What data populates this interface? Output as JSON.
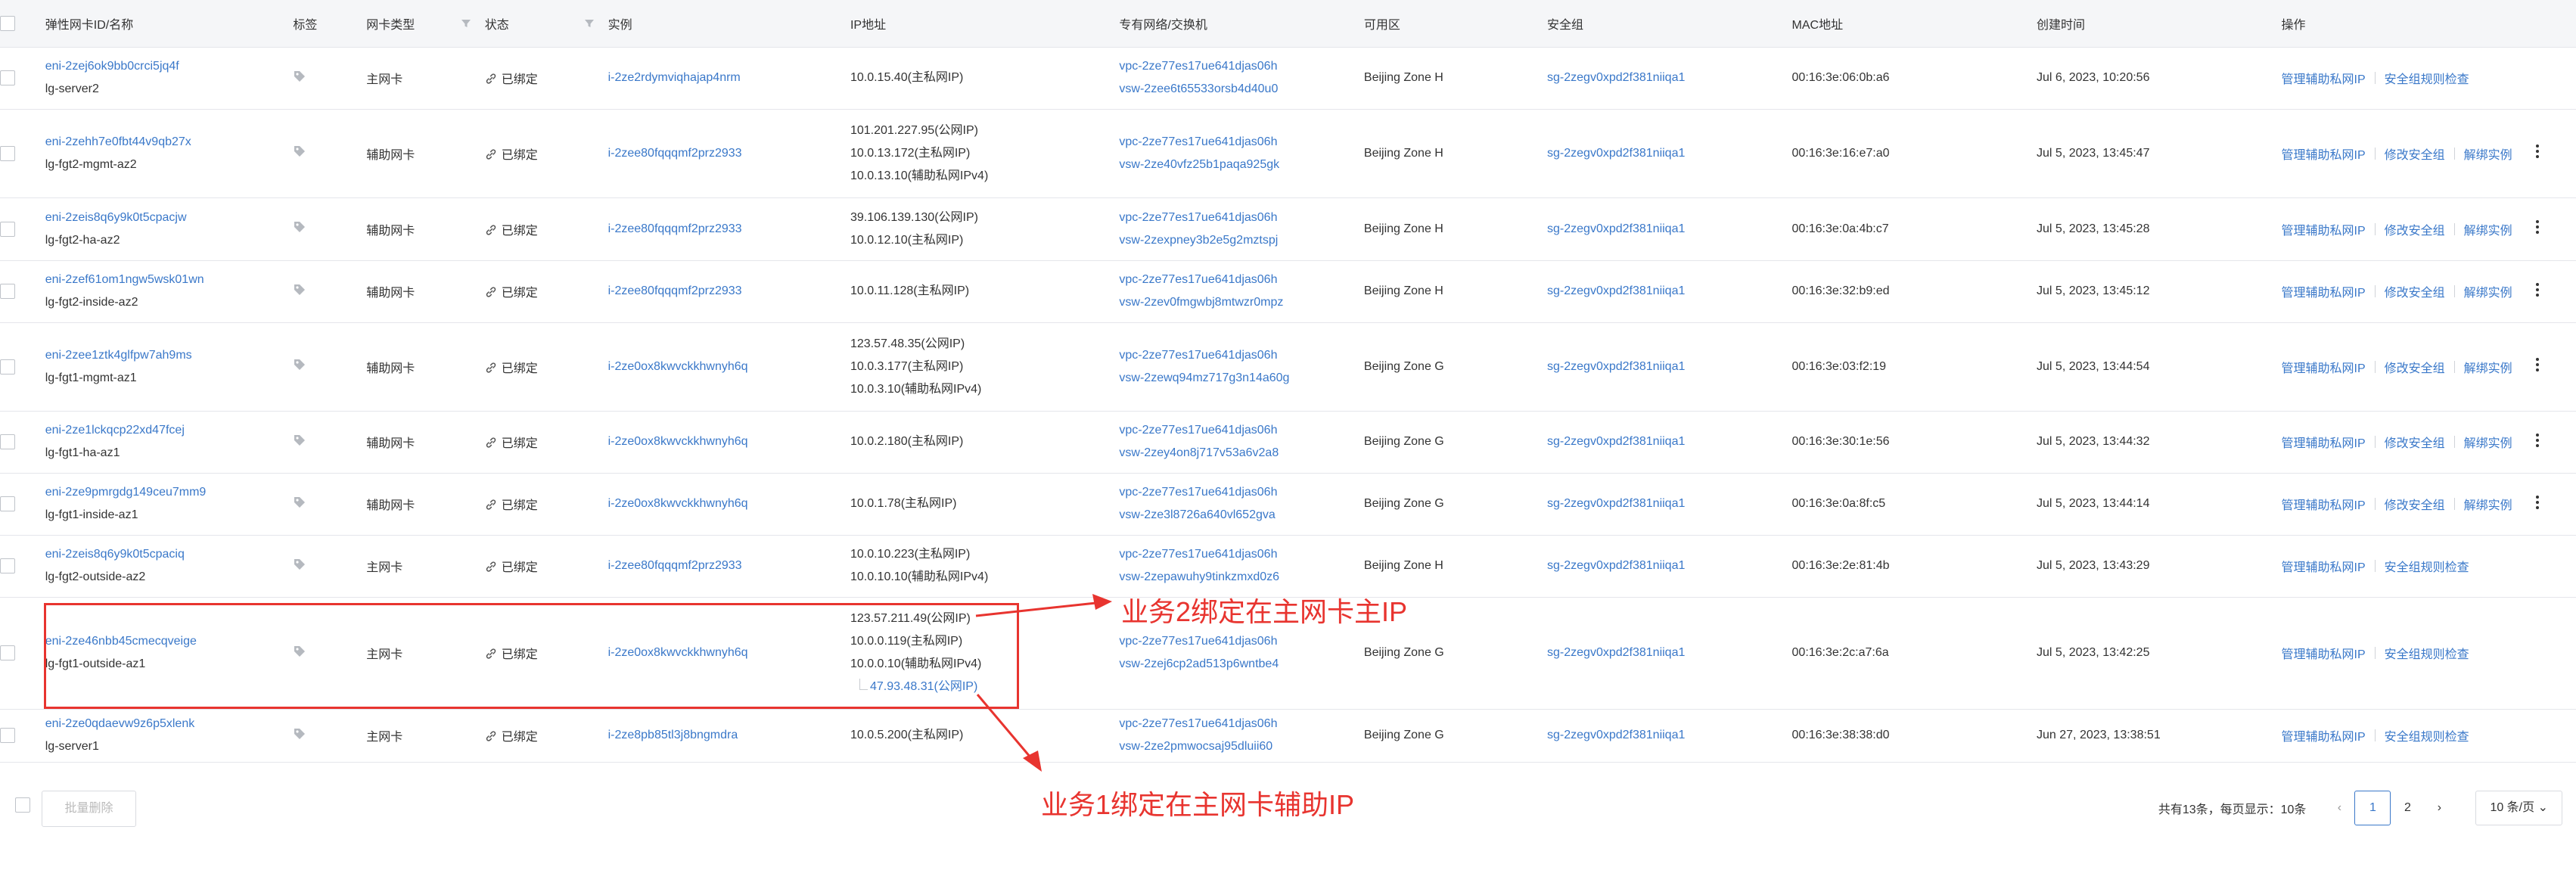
{
  "headers": {
    "id": "弹性网卡ID/名称",
    "tag": "标签",
    "type": "网卡类型",
    "status": "状态",
    "instance": "实例",
    "ip": "IP地址",
    "vpc": "专有网络/交换机",
    "zone": "可用区",
    "sg": "安全组",
    "mac": "MAC地址",
    "created": "创建时间",
    "ops": "操作"
  },
  "ops": {
    "manage_ip": "管理辅助私网IP",
    "sg_check": "安全组规则检查",
    "modify_sg": "修改安全组",
    "unbind": "解绑实例"
  },
  "rows": [
    {
      "id": "eni-2zej6ok9bb0crci5jq4f",
      "name": "lg-server2",
      "type": "主网卡",
      "status": "已绑定",
      "instance": "i-2ze2rdymviqhajap4nrm",
      "ips": [
        "10.0.15.40(主私网IP)"
      ],
      "vpc": "vpc-2ze77es17ue641djas06h",
      "vsw": "vsw-2zee6t65533orsb4d40u0",
      "zone": "Beijing Zone H",
      "sg": "sg-2zegv0xpd2f381niiqa1",
      "mac": "00:16:3e:06:0b:a6",
      "created": "Jul 6, 2023, 10:20:56",
      "op2": "安全组规则检查",
      "op3": "",
      "more": false
    },
    {
      "id": "eni-2zehh7e0fbt44v9qb27x",
      "name": "lg-fgt2-mgmt-az2",
      "type": "辅助网卡",
      "status": "已绑定",
      "instance": "i-2zee80fqqqmf2prz2933",
      "ips": [
        "101.201.227.95(公网IP)",
        "10.0.13.172(主私网IP)",
        "10.0.13.10(辅助私网IPv4)"
      ],
      "vpc": "vpc-2ze77es17ue641djas06h",
      "vsw": "vsw-2ze40vfz25b1paqa925gk",
      "zone": "Beijing Zone H",
      "sg": "sg-2zegv0xpd2f381niiqa1",
      "mac": "00:16:3e:16:e7:a0",
      "created": "Jul 5, 2023, 13:45:47",
      "op2": "修改安全组",
      "op3": "解绑实例",
      "more": true
    },
    {
      "id": "eni-2zeis8q6y9k0t5cpacjw",
      "name": "lg-fgt2-ha-az2",
      "type": "辅助网卡",
      "status": "已绑定",
      "instance": "i-2zee80fqqqmf2prz2933",
      "ips": [
        "39.106.139.130(公网IP)",
        "10.0.12.10(主私网IP)"
      ],
      "vpc": "vpc-2ze77es17ue641djas06h",
      "vsw": "vsw-2zexpney3b2e5g2mztspj",
      "zone": "Beijing Zone H",
      "sg": "sg-2zegv0xpd2f381niiqa1",
      "mac": "00:16:3e:0a:4b:c7",
      "created": "Jul 5, 2023, 13:45:28",
      "op2": "修改安全组",
      "op3": "解绑实例",
      "more": true
    },
    {
      "id": "eni-2zef61om1ngw5wsk01wn",
      "name": "lg-fgt2-inside-az2",
      "type": "辅助网卡",
      "status": "已绑定",
      "instance": "i-2zee80fqqqmf2prz2933",
      "ips": [
        "10.0.11.128(主私网IP)"
      ],
      "vpc": "vpc-2ze77es17ue641djas06h",
      "vsw": "vsw-2zev0fmgwbj8mtwzr0mpz",
      "zone": "Beijing Zone H",
      "sg": "sg-2zegv0xpd2f381niiqa1",
      "mac": "00:16:3e:32:b9:ed",
      "created": "Jul 5, 2023, 13:45:12",
      "op2": "修改安全组",
      "op3": "解绑实例",
      "more": true
    },
    {
      "id": "eni-2zee1ztk4glfpw7ah9ms",
      "name": "lg-fgt1-mgmt-az1",
      "type": "辅助网卡",
      "status": "已绑定",
      "instance": "i-2ze0ox8kwvckkhwnyh6q",
      "ips": [
        "123.57.48.35(公网IP)",
        "10.0.3.177(主私网IP)",
        "10.0.3.10(辅助私网IPv4)"
      ],
      "vpc": "vpc-2ze77es17ue641djas06h",
      "vsw": "vsw-2zewq94mz717g3n14a60g",
      "zone": "Beijing Zone G",
      "sg": "sg-2zegv0xpd2f381niiqa1",
      "mac": "00:16:3e:03:f2:19",
      "created": "Jul 5, 2023, 13:44:54",
      "op2": "修改安全组",
      "op3": "解绑实例",
      "more": true
    },
    {
      "id": "eni-2ze1lckqcp22xd47fcej",
      "name": "lg-fgt1-ha-az1",
      "type": "辅助网卡",
      "status": "已绑定",
      "instance": "i-2ze0ox8kwvckkhwnyh6q",
      "ips": [
        "10.0.2.180(主私网IP)"
      ],
      "vpc": "vpc-2ze77es17ue641djas06h",
      "vsw": "vsw-2zey4on8j717v53a6v2a8",
      "zone": "Beijing Zone G",
      "sg": "sg-2zegv0xpd2f381niiqa1",
      "mac": "00:16:3e:30:1e:56",
      "created": "Jul 5, 2023, 13:44:32",
      "op2": "修改安全组",
      "op3": "解绑实例",
      "more": true
    },
    {
      "id": "eni-2ze9pmrgdg149ceu7mm9",
      "name": "lg-fgt1-inside-az1",
      "type": "辅助网卡",
      "status": "已绑定",
      "instance": "i-2ze0ox8kwvckkhwnyh6q",
      "ips": [
        "10.0.1.78(主私网IP)"
      ],
      "vpc": "vpc-2ze77es17ue641djas06h",
      "vsw": "vsw-2ze3l8726a640vl652gva",
      "zone": "Beijing Zone G",
      "sg": "sg-2zegv0xpd2f381niiqa1",
      "mac": "00:16:3e:0a:8f:c5",
      "created": "Jul 5, 2023, 13:44:14",
      "op2": "修改安全组",
      "op3": "解绑实例",
      "more": true
    },
    {
      "id": "eni-2zeis8q6y9k0t5cpaciq",
      "name": "lg-fgt2-outside-az2",
      "type": "主网卡",
      "status": "已绑定",
      "instance": "i-2zee80fqqqmf2prz2933",
      "ips": [
        "10.0.10.223(主私网IP)",
        "10.0.10.10(辅助私网IPv4)"
      ],
      "vpc": "vpc-2ze77es17ue641djas06h",
      "vsw": "vsw-2zepawuhy9tinkzmxd0z6",
      "zone": "Beijing Zone H",
      "sg": "sg-2zegv0xpd2f381niiqa1",
      "mac": "00:16:3e:2e:81:4b",
      "created": "Jul 5, 2023, 13:43:29",
      "op2": "安全组规则检查",
      "op3": "",
      "more": false
    },
    {
      "id": "eni-2ze46nbb45cmecqveige",
      "name": "lg-fgt1-outside-az1",
      "type": "主网卡",
      "status": "已绑定",
      "instance": "i-2ze0ox8kwvckkhwnyh6q",
      "ips": [
        "123.57.211.49(公网IP)",
        "10.0.0.119(主私网IP)",
        "10.0.0.10(辅助私网IPv4)"
      ],
      "sub_ip": "47.93.48.31(公网IP)",
      "vpc": "vpc-2ze77es17ue641djas06h",
      "vsw": "vsw-2zej6cp2ad513p6wntbe4",
      "zone": "Beijing Zone G",
      "sg": "sg-2zegv0xpd2f381niiqa1",
      "mac": "00:16:3e:2c:a7:6a",
      "created": "Jul 5, 2023, 13:42:25",
      "op2": "安全组规则检查",
      "op3": "",
      "more": false
    },
    {
      "id": "eni-2ze0qdaevw9z6p5xlenk",
      "name": "lg-server1",
      "type": "主网卡",
      "status": "已绑定",
      "instance": "i-2ze8pb85tl3j8bngmdra",
      "ips": [
        "10.0.5.200(主私网IP)"
      ],
      "vpc": "vpc-2ze77es17ue641djas06h",
      "vsw": "vsw-2ze2pmwocsaj95dluii60",
      "zone": "Beijing Zone G",
      "sg": "sg-2zegv0xpd2f381niiqa1",
      "mac": "00:16:3e:38:38:d0",
      "created": "Jun 27, 2023, 13:38:51",
      "op2": "安全组规则检查",
      "op3": "",
      "more": false
    }
  ],
  "annotations": {
    "a1": "业务2绑定在主网卡主IP",
    "a2": "业务1绑定在主网卡辅助IP"
  },
  "footer": {
    "batch_delete": "批量删除",
    "total": "共有13条，每页显示：10条",
    "pages": [
      "1",
      "2"
    ],
    "active_page": "1",
    "page_size": "10 条/页"
  },
  "colors": {
    "link": "#3a78c9",
    "annotation": "#e8342f",
    "header_bg": "#f5f6f8"
  }
}
